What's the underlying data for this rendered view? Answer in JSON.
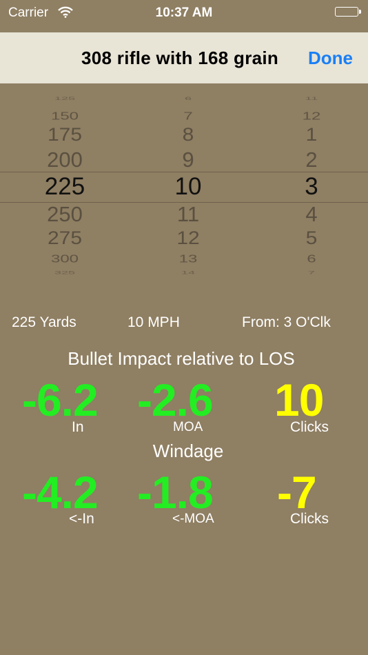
{
  "status_bar": {
    "carrier": "Carrier",
    "time": "10:37 AM"
  },
  "nav": {
    "title": "308 rifle with 168 grain",
    "done_label": "Done"
  },
  "picker": {
    "range": [
      "125",
      "150",
      "175",
      "200",
      "225",
      "250",
      "275",
      "300",
      "325"
    ],
    "wind_speed": [
      "6",
      "7",
      "8",
      "9",
      "10",
      "11",
      "12",
      "13",
      "14"
    ],
    "direction": [
      "11",
      "12",
      "1",
      "2",
      "3",
      "4",
      "5",
      "6",
      "7"
    ]
  },
  "summary": {
    "range": "225 Yards",
    "wind": "10 MPH",
    "direction": "From: 3 O'Clk"
  },
  "elevation": {
    "heading": "Bullet Impact relative to LOS",
    "inches": "-6.2",
    "inches_unit": "In",
    "moa": "-2.6",
    "moa_unit": "MOA",
    "clicks": "10",
    "clicks_unit": "Clicks"
  },
  "windage": {
    "heading": "Windage",
    "inches": "-4.2",
    "inches_unit": "<-In",
    "moa": "-1.8",
    "moa_unit": "<-MOA",
    "clicks": "-7",
    "clicks_unit": "Clicks"
  },
  "colors": {
    "background": "#8f7f63",
    "nav": "#e8e4d6",
    "accent": "#1a7ff5",
    "value_green": "#22ee22",
    "value_yellow": "#ffff00"
  },
  "icons": {
    "wifi": "wifi-icon",
    "battery": "battery-icon"
  }
}
